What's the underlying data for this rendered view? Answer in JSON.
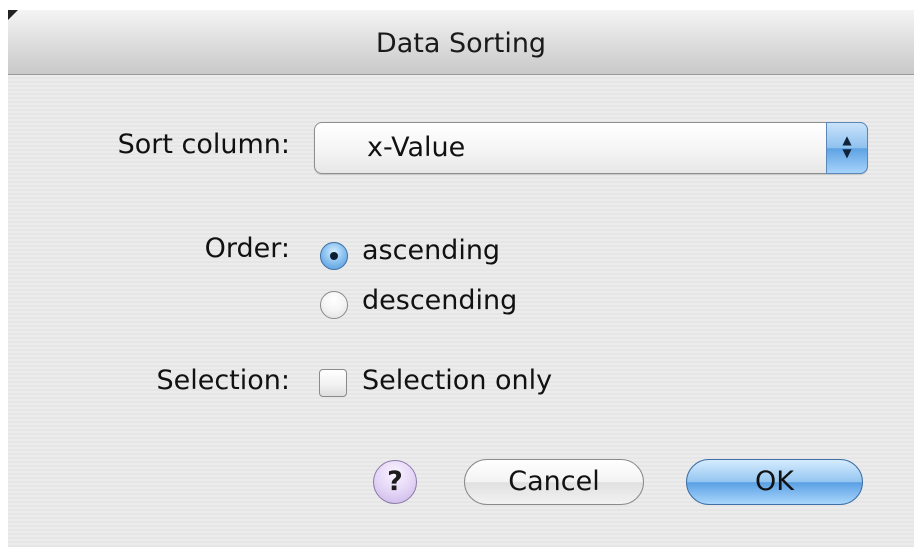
{
  "window": {
    "title": "Data Sorting"
  },
  "sort_column": {
    "label": "Sort column:",
    "selected": "x-Value",
    "arrow_up": "▲",
    "arrow_down": "▼"
  },
  "order": {
    "label": "Order:",
    "options": [
      {
        "label": "ascending",
        "selected": true
      },
      {
        "label": "descending",
        "selected": false
      }
    ]
  },
  "selection": {
    "label": "Selection:",
    "checkbox_label": "Selection only",
    "checked": false
  },
  "buttons": {
    "help": "?",
    "cancel": "Cancel",
    "ok": "OK"
  },
  "colors": {
    "accent": "#5da2e3",
    "help_button": "#c7b2e6",
    "panel": "#ececec"
  }
}
